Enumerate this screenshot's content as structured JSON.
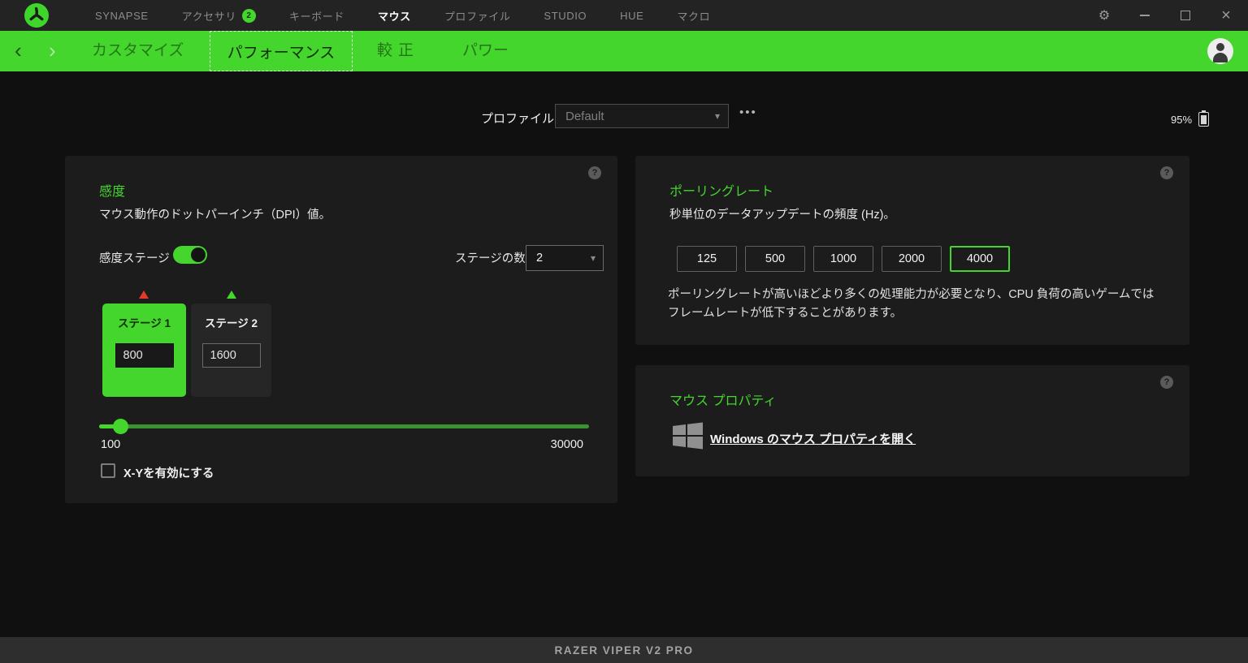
{
  "colors": {
    "accent": "#44d62c",
    "stage1_marker": "#e03a2a",
    "stage2_marker": "#44d62c",
    "titlebar_bg": "#232323",
    "panel_bg": "#1c1c1c"
  },
  "icons": {
    "back": "‹",
    "forward": "›",
    "gear": "⚙",
    "close": "×",
    "caret_down": "▾",
    "more": "•••",
    "help": "?"
  },
  "titlebar": {
    "nav": [
      {
        "label": "SYNAPSE"
      },
      {
        "label": "アクセサリ",
        "badge": "2"
      },
      {
        "label": "キーボード"
      },
      {
        "label": "マウス"
      },
      {
        "label": "プロファイル"
      },
      {
        "label": "STUDIO"
      },
      {
        "label": "HUE"
      },
      {
        "label": "マクロ"
      }
    ]
  },
  "subnav": {
    "tabs": [
      {
        "label": "カスタマイズ"
      },
      {
        "label": "パフォーマンス"
      },
      {
        "label": "較正"
      },
      {
        "label": "パワー"
      }
    ]
  },
  "profile_bar": {
    "label": "プロファイル",
    "selected_profile": "Default",
    "battery_percent": "95%"
  },
  "sensitivity": {
    "title": "感度",
    "description": "マウス動作のドットパーインチ（DPI）値。",
    "toggle_label": "感度ステージ",
    "toggle_on": true,
    "stage_count_label": "ステージの数",
    "stage_count_value": "2",
    "stages": [
      {
        "label": "ステージ 1",
        "value": "800",
        "active": true
      },
      {
        "label": "ステージ 2",
        "value": "1600",
        "active": false
      }
    ],
    "slider": {
      "min_label": "100",
      "max_label": "30000",
      "current_value": "800"
    },
    "xy_label": "X-Yを有効にする",
    "xy_checked": false
  },
  "polling": {
    "title": "ポーリングレート",
    "description": "秒単位のデータアップデートの頻度 (Hz)。",
    "options": [
      "125",
      "500",
      "1000",
      "2000",
      "4000"
    ],
    "selected": "4000",
    "note": "ポーリングレートが高いほどより多くの処理能力が必要となり、CPU 負荷の高いゲームではフレームレートが低下することがあります。"
  },
  "mouse_props": {
    "title": "マウス プロパティ",
    "link_label": "Windows のマウス プロパティを開く"
  },
  "footer": {
    "device_name": "RAZER VIPER V2 PRO"
  }
}
